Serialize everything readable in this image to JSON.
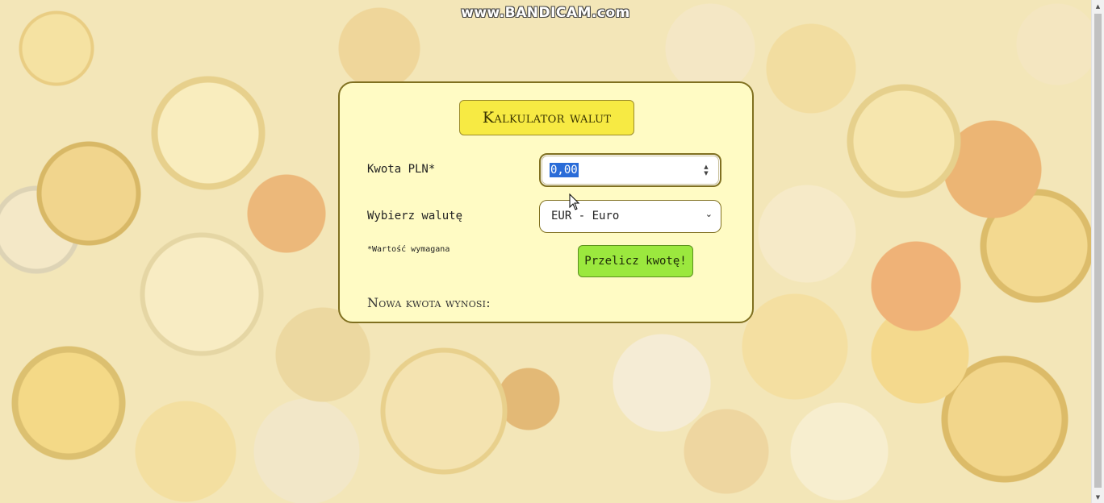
{
  "watermark": "www.BANDICAM.com",
  "calculator": {
    "title": "Kalkulator walut",
    "amount_label": "Kwota PLN*",
    "amount_value": "0,00",
    "currency_label": "Wybierz walutę",
    "currency_selected": "EUR - Euro",
    "required_note": "*Wartość wymagana",
    "convert_button": "Przelicz kwotę!",
    "result_label": "Nowa kwota wynosi:"
  },
  "colors": {
    "card_background": "#fffbc4",
    "card_border": "#807020",
    "title_background": "#f7ea43",
    "button_background": "#9be83e"
  },
  "icons": {
    "spinner": "number-spinner-icon",
    "select": "chevron-down-icon",
    "cursor": "mouse-pointer-icon"
  }
}
